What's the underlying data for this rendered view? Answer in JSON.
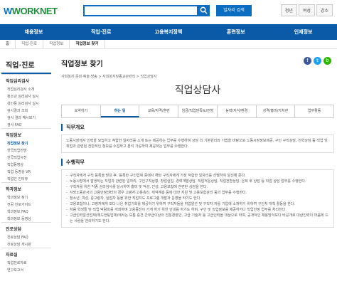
{
  "header": {
    "logo_text": "WORKNET",
    "logo_prefix": "W",
    "search_placeholder": "",
    "job_search_label": "일자리 검색",
    "user_tabs": [
      "청년",
      "여성",
      "강소"
    ]
  },
  "gnb": [
    "채용정보",
    "직업·진로",
    "고용복지정책",
    "훈련정보",
    "인재정보"
  ],
  "breadcrumb": [
    "홈",
    "직업·진로",
    "직업정보",
    "직업정보 찾기"
  ],
  "sidebar": {
    "title": "직업·진로",
    "sections": [
      {
        "title": "직업심리검사",
        "items": [
          "직업심리검사 소개",
          "청소년 심리검사 실시",
          "성인용 심리검사 실시",
          "검사결과 조회",
          "검사 결과 예시보기",
          "검사 FAQ"
        ]
      },
      {
        "title": "직업정보",
        "items": [
          "직업정보 찾기",
          "한국직업전망",
          "한국직업사전",
          "직업동영상",
          "직업 동영상 VR",
          "직업인 인터뷰"
        ],
        "active": "직업정보 찾기"
      },
      {
        "title": "학과정보",
        "items": [
          "학과정보 찾기",
          "전공 진로가이드",
          "학과정보 FAQ",
          "학과정보 동영상"
        ]
      },
      {
        "title": "진로상담",
        "items": [
          "진로상담 FAQ",
          "진로상담 게시판"
        ]
      },
      {
        "title": "자료실",
        "items": [
          "직업진로자료",
          "연구보고서"
        ]
      }
    ]
  },
  "main": {
    "page_title": "직업정보 찾기",
    "sub_breadcrumb": "사회복지·문화·예술·방송  >  사회복지및종교관련직  >  직업상담사",
    "job_title": "직업상담사",
    "tabs": [
      "요약하기",
      "하는 일",
      "교육/자격/훈련",
      "임금/직업만족도/전망",
      "능력/지식/환경",
      "성격/흥미/가치관",
      "업무활동"
    ],
    "active_tab": "하는 일",
    "overview_heading": "직무개요",
    "overview_text": "노동시장에서 인력을 모집하고 적합한 일자리를 소개 또는 제공하는 업무를 수행하며 상담 의 기본원리와 기법을 바탕으로 노동시장정보제공, 구인 구직상담, 진학상담 등 직업 및 취업과 관련된 전반적인 정보를 수집하고 분석 가공하여 제공하는 업무를 수행한다.",
    "duties_heading": "수행직무",
    "duties": [
      "구직자에게 구직 등록을 받은 후, 등록한 구인업체 중에서 해당 구직자에게 가장 적합한 일자리를 선별하여 알선해 준다.",
      "노동시장에서 발생되는 직업과 관련된 일자리, 구인구직상황, 창업실업, 경력개발상담, 직업적응상담, 직업전환상담, 은퇴 후 상담 등 직업 상담 업무를 수행한다.",
      "구직자를 위한 각종 심리검사를 실시하여 흥미 및 적성, 인성, 고용보험에 관련된 상담을 한다.",
      "지방노동관서의 고용안정센터의 경우 고령자·고용촉진, 취약계층 등에 대한 지원 및 고용보험관리 등의 업무를 수행한다.",
      "청소년, 여성, 중고령자, 실업자 등을 위한 직업지도 프로그램 개발과 운영을 하기도 한다.",
      "고용보험이나, 고령자에게 보다 나은 취업기회를 제공하기 위하여 구직자들을 취업알선 및 구직자 자를 기업에 소개하기 위하여 구인처 개척 활동을 한다.",
      "처음 학생들 및 직업 박람회를 개최하며 고용증진이 가게 하기 위한 안내를 하기도 하며, 구인 및 직업정보를 제공하거나 직업안정 업무를 처리한다.",
      "고급인력알선업체(헤드헌팅업체)에서는 보통 중견 간부급이상의 전문경영인, 고급 기술자 등 고급인력을 대상으로 하며, 공개적인 채용방식보다 비공개로 대상인력이 마음에 드는 사람을 관리하기도 한다."
    ]
  }
}
